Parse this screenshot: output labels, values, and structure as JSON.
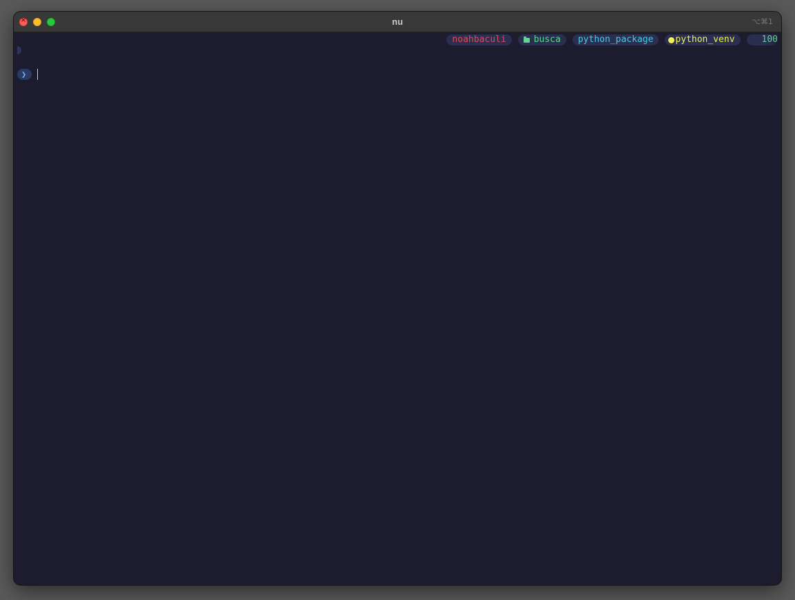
{
  "window": {
    "title": "nu",
    "shortcut": "⌥⌘1"
  },
  "status_bar": {
    "user": "noahbaculi",
    "directory": "busca",
    "package": "python_package",
    "venv": "python_venv",
    "number": "100"
  },
  "prompt": {
    "symbol": "❯",
    "input_value": ""
  },
  "colors": {
    "background": "#1c1c2e",
    "segment_bg": "#2a2f4f",
    "user": "#e04a5a",
    "directory": "#5fd39a",
    "package": "#4fc7e8",
    "venv": "#f0f05a",
    "number": "#5fd39a"
  },
  "icons": {
    "directory": "folder-icon",
    "venv": "python-icon"
  }
}
